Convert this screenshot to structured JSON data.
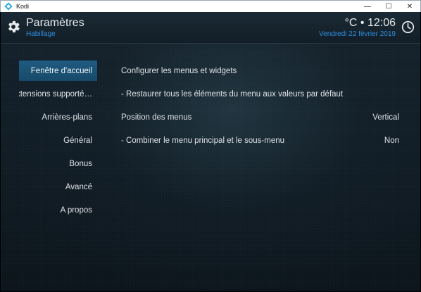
{
  "window": {
    "title": "Kodi",
    "controls": {
      "minimize": "—",
      "maximize": "☐",
      "close": "✕"
    }
  },
  "header": {
    "title": "Paramètres",
    "subtitle": "Habillage",
    "temp_time": "°C • 12:06",
    "date": "Vendredi 22 février 2019",
    "icons": [
      "gear-icon",
      "clock-icon"
    ]
  },
  "sidebar": {
    "items": [
      {
        "label": "Fenêtre d'accueil",
        "active": true
      },
      {
        "label": "Extensions supporté…"
      },
      {
        "label": "Arrières-plans"
      },
      {
        "label": "Général"
      },
      {
        "label": "Bonus"
      },
      {
        "label": "Avancé"
      },
      {
        "label": "A propos"
      }
    ]
  },
  "settings": {
    "rows": [
      {
        "label": "Configurer les menus et widgets",
        "value": ""
      },
      {
        "label": "- Restaurer tous les éléments du menu aux valeurs par défaut",
        "value": ""
      },
      {
        "label": "Position des menus",
        "value": "Vertical"
      },
      {
        "label": "- Combiner le menu principal et le sous-menu",
        "value": "Non"
      }
    ]
  },
  "colors": {
    "accent": "#2e8ee0",
    "selection": "#1f5b80",
    "background": "#101c25"
  }
}
